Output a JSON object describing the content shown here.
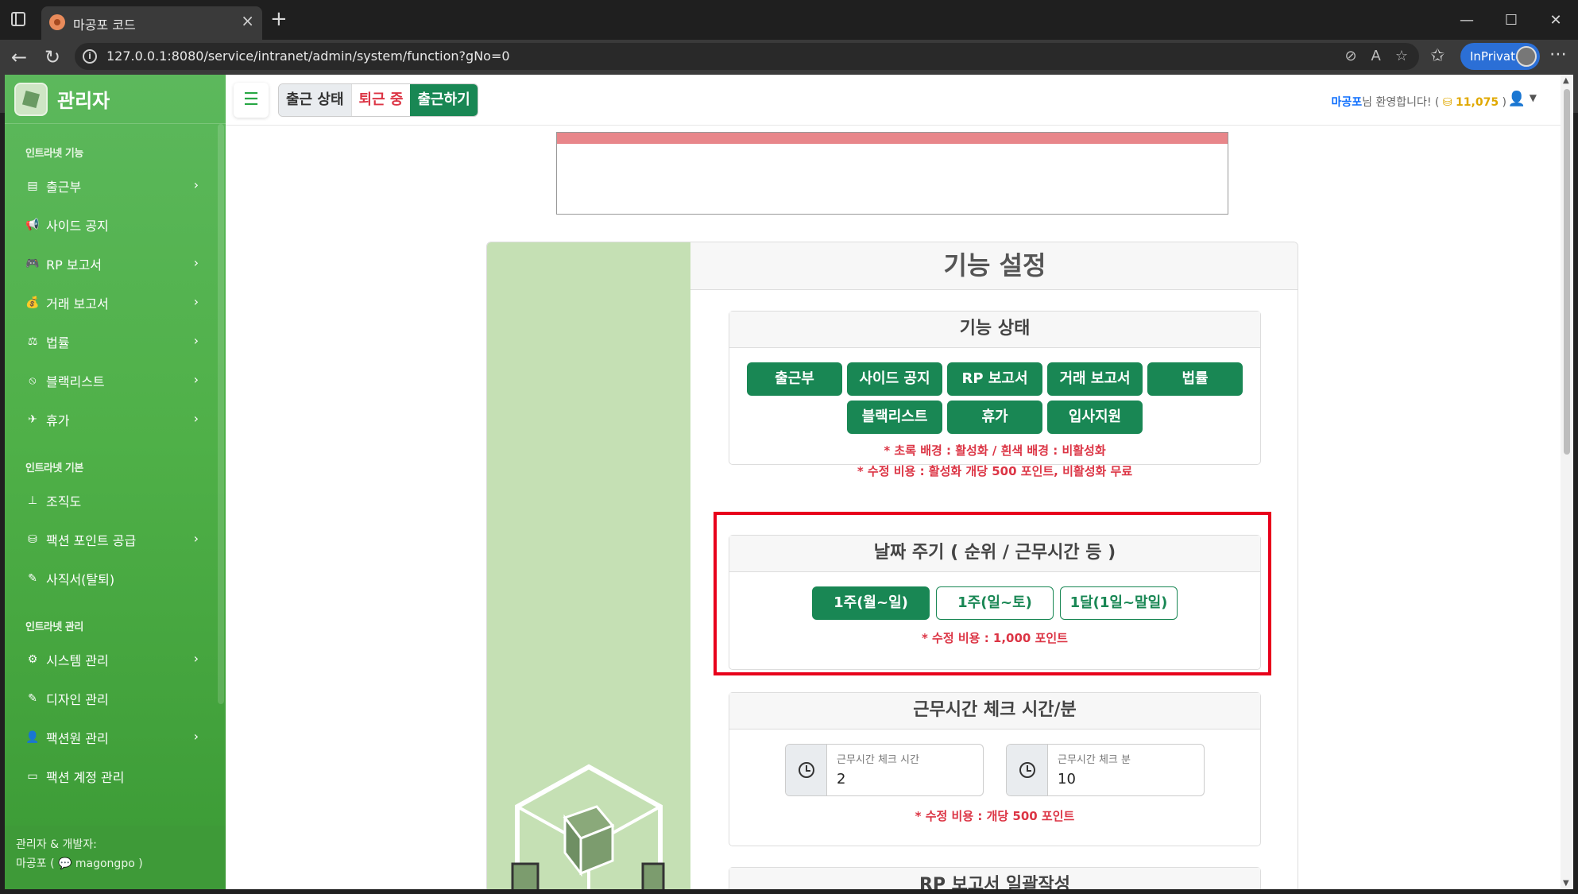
{
  "browser": {
    "tab_title": "마공포 코드",
    "url": "127.0.0.1:8080/service/intranet/admin/system/function?gNo=0",
    "inprivate_label": "InPrivate"
  },
  "sidebar": {
    "brand": "관리자",
    "sections": [
      {
        "title": "인트라넷 기능",
        "items": [
          {
            "label": "출근부",
            "icon": "book-icon",
            "glyph": "▤",
            "chevron": true
          },
          {
            "label": "사이드 공지",
            "icon": "megaphone-icon",
            "glyph": "📢",
            "chevron": false
          },
          {
            "label": "RP 보고서",
            "icon": "gamepad-icon",
            "glyph": "🎮",
            "chevron": true
          },
          {
            "label": "거래 보고서",
            "icon": "money-bag-icon",
            "glyph": "💰",
            "chevron": true
          },
          {
            "label": "법률",
            "icon": "scale-icon",
            "glyph": "⚖",
            "chevron": true
          },
          {
            "label": "블랙리스트",
            "icon": "ban-icon",
            "glyph": "⦸",
            "chevron": true
          },
          {
            "label": "휴가",
            "icon": "plane-icon",
            "glyph": "✈",
            "chevron": true
          }
        ]
      },
      {
        "title": "인트라넷 기본",
        "items": [
          {
            "label": "조직도",
            "icon": "sitemap-icon",
            "glyph": "⊥",
            "chevron": false
          },
          {
            "label": "팩션 포인트 공급",
            "icon": "coins-icon",
            "glyph": "⛁",
            "chevron": true
          },
          {
            "label": "사직서(탈퇴)",
            "icon": "pen-icon",
            "glyph": "✎",
            "chevron": false
          }
        ]
      },
      {
        "title": "인트라넷 관리",
        "items": [
          {
            "label": "시스템 관리",
            "icon": "gear-icon",
            "glyph": "⚙",
            "chevron": true
          },
          {
            "label": "디자인 관리",
            "icon": "brush-icon",
            "glyph": "✎",
            "chevron": false
          },
          {
            "label": "팩션원 관리",
            "icon": "user-gear-icon",
            "glyph": "👤",
            "chevron": true
          },
          {
            "label": "팩션 계정 관리",
            "icon": "id-card-icon",
            "glyph": "▭",
            "chevron": false
          }
        ]
      }
    ],
    "footer_line1": "관리자 & 개발자:",
    "footer_line2": "마공포 ( 💬 magongpo )"
  },
  "topbar": {
    "status_label": "출근 상태",
    "off_label": "퇴근 중",
    "go_label": "출근하기",
    "welcome_name": "마공포",
    "welcome_text": "님 환영합니다! (",
    "points": "11,075",
    "welcome_close": ")"
  },
  "main": {
    "title": "기능 설정",
    "feature_status": {
      "heading": "기능 상태",
      "buttons": [
        "출근부",
        "사이드 공지",
        "RP 보고서",
        "거래 보고서",
        "법률",
        "블랙리스트",
        "휴가",
        "입사지원"
      ],
      "note1": "* 초록 배경 : 활성화 / 흰색 배경 : 비활성화",
      "note2": "* 수정 비용 : 활성화 개당 500 포인트, 비활성화 무료"
    },
    "date_cycle": {
      "heading": "날짜 주기 ( 순위 / 근무시간 등 )",
      "options": [
        "1주(월~일)",
        "1주(일~토)",
        "1달(1일~말일)"
      ],
      "selected": "1주(월~일)",
      "note": "* 수정 비용 : 1,000 포인트"
    },
    "work_check": {
      "heading": "근무시간 체크 시간/분",
      "hour_label": "근무시간 체크 시간",
      "hour_value": "2",
      "minute_label": "근무시간 체크 분",
      "minute_value": "10",
      "note": "* 수정 비용 : 개당 500 포인트"
    },
    "rp_batch": {
      "heading": "RP 보고서 일괄작성"
    }
  },
  "colors": {
    "primary_green": "#198754",
    "sidebar_green": "#4fb048",
    "highlight_red": "#e8001b",
    "note_red": "#dc3545"
  }
}
